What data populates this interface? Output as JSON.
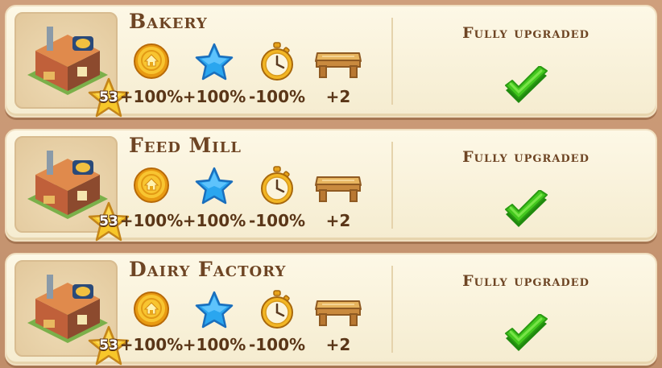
{
  "buildings": [
    {
      "name": "Bakery",
      "level": "53",
      "stats": [
        {
          "icon": "coin-icon",
          "value": "+100%"
        },
        {
          "icon": "star-icon",
          "value": "+100%"
        },
        {
          "icon": "stopwatch-icon",
          "value": "-100%"
        },
        {
          "icon": "table-icon",
          "value": "+2"
        }
      ],
      "status": "Fully upgraded",
      "status_icon": "checkmark-icon"
    },
    {
      "name": "Feed Mill",
      "level": "53",
      "stats": [
        {
          "icon": "coin-icon",
          "value": "+100%"
        },
        {
          "icon": "star-icon",
          "value": "+100%"
        },
        {
          "icon": "stopwatch-icon",
          "value": "-100%"
        },
        {
          "icon": "table-icon",
          "value": "+2"
        }
      ],
      "status": "Fully upgraded",
      "status_icon": "checkmark-icon"
    },
    {
      "name": "Dairy Factory",
      "level": "53",
      "stats": [
        {
          "icon": "coin-icon",
          "value": "+100%"
        },
        {
          "icon": "star-icon",
          "value": "+100%"
        },
        {
          "icon": "stopwatch-icon",
          "value": "-100%"
        },
        {
          "icon": "table-icon",
          "value": "+2"
        }
      ],
      "status": "Fully upgraded",
      "status_icon": "checkmark-icon"
    }
  ],
  "colors": {
    "card_bg": "#fbf5df",
    "title": "#6e4524",
    "coin": "#f4b321",
    "star": "#2ea8f0",
    "check": "#3cc21a",
    "level_star": "#f7c72a"
  }
}
